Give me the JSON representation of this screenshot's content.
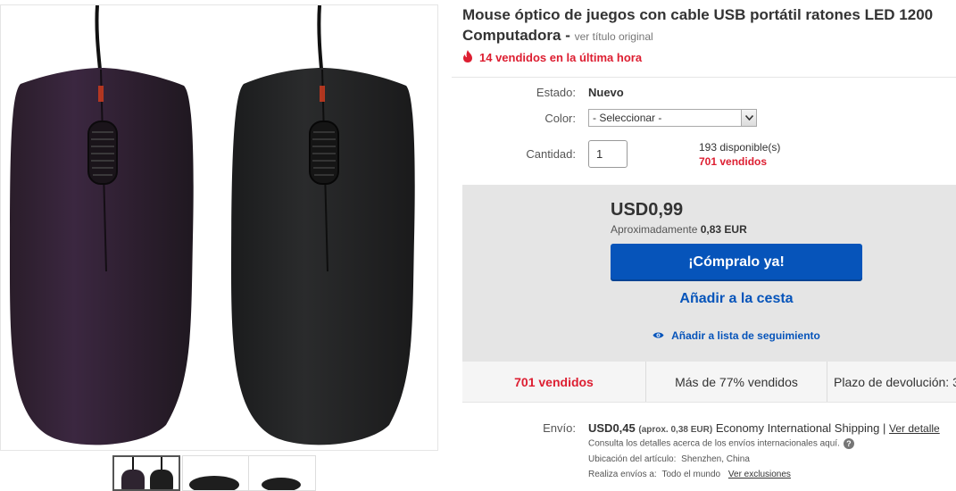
{
  "title": {
    "line1": "Mouse óptico de juegos con cable USB portátil ratones LED 1200",
    "line2": "Computadora - ",
    "orig_link": "ver título original"
  },
  "hot": {
    "text": "14 vendidos en la última hora",
    "icon": "fire-icon"
  },
  "fields": {
    "condition_label": "Estado:",
    "condition_value": "Nuevo",
    "color_label": "Color:",
    "color_selected": "- Seleccionar -",
    "qty_label": "Cantidad:",
    "qty_value": "1",
    "available": "193 disponible(s)",
    "sold": "701 vendidos"
  },
  "buy": {
    "price": "USD0,99",
    "approx_label": "Aproximadamente",
    "approx_value": "0,83 EUR",
    "buy_now": "¡Cómpralo ya!",
    "add_cart": "Añadir a la cesta",
    "watch": "Añadir a lista de seguimiento"
  },
  "stats": {
    "sold": "701 vendidos",
    "percent": "Más de 77% vendidos",
    "returns": "Plazo de devolución: 3"
  },
  "shipping": {
    "label": "Envío:",
    "price": "USD0,45",
    "approx": "(aprox. 0,38 EUR)",
    "method": "Economy International Shipping",
    "sep": "|",
    "details_link": "Ver detalle",
    "note": "Consulta los detalles acerca de los envíos internacionales aquí.",
    "location_label": "Ubicación del artículo:",
    "location_value": "Shenzhen, China",
    "ships_to_label": "Realiza envíos a:",
    "ships_to_value": "Todo el mundo",
    "exclusions_link": "Ver exclusiones"
  },
  "colors": {
    "accent_blue": "#0654ba",
    "sold_red": "#dd1e31"
  }
}
